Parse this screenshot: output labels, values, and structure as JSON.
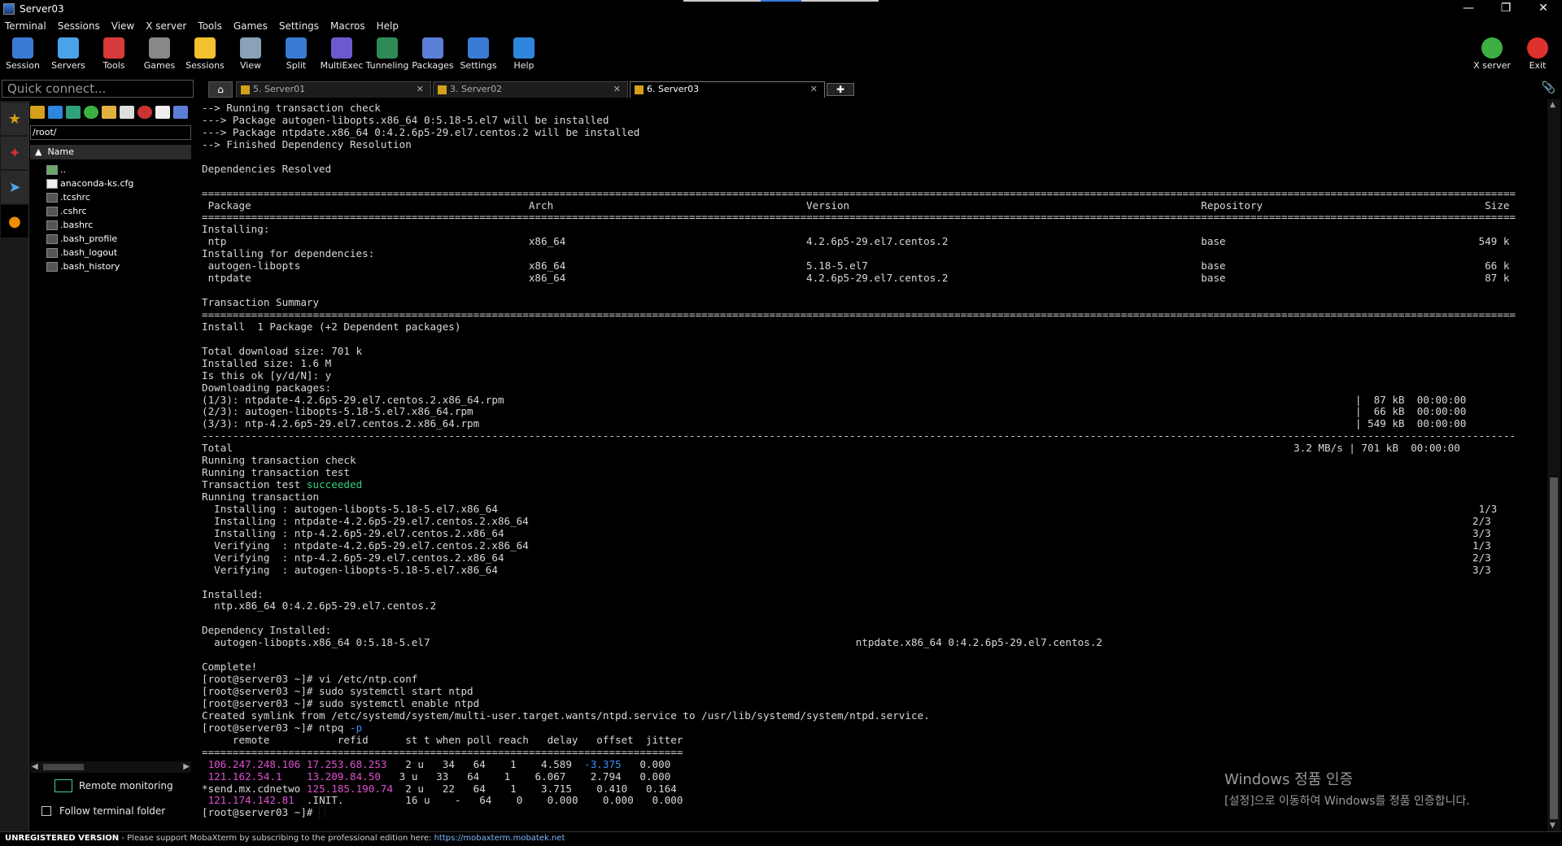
{
  "window": {
    "title": "Server03"
  },
  "menu": [
    "Terminal",
    "Sessions",
    "View",
    "X server",
    "Tools",
    "Games",
    "Settings",
    "Macros",
    "Help"
  ],
  "toolbar": [
    {
      "label": "Session",
      "icon": "session-icon",
      "color": "#3a7bd5"
    },
    {
      "label": "Servers",
      "icon": "servers-icon",
      "color": "#4aa3e8"
    },
    {
      "label": "Tools",
      "icon": "tools-icon",
      "color": "#d63a3a"
    },
    {
      "label": "Games",
      "icon": "games-icon",
      "color": "#888888"
    },
    {
      "label": "Sessions",
      "icon": "star-icon",
      "color": "#f2c12e"
    },
    {
      "label": "View",
      "icon": "view-icon",
      "color": "#8aa1b8"
    },
    {
      "label": "Split",
      "icon": "split-icon",
      "color": "#3a7bd5"
    },
    {
      "label": "MultiExec",
      "icon": "multiexec-icon",
      "color": "#6a5acd"
    },
    {
      "label": "Tunneling",
      "icon": "tunneling-icon",
      "color": "#2e8b57"
    },
    {
      "label": "Packages",
      "icon": "packages-icon",
      "color": "#5b7fd6"
    },
    {
      "label": "Settings",
      "icon": "gear-icon",
      "color": "#3a7bd5"
    },
    {
      "label": "Help",
      "icon": "help-icon",
      "color": "#2e86de"
    }
  ],
  "toolbar_right": [
    {
      "label": "X server",
      "icon": "xserver-icon",
      "color": "#3cb043"
    },
    {
      "label": "Exit",
      "icon": "power-icon",
      "color": "#e03030"
    }
  ],
  "quick_connect": {
    "placeholder": "Quick connect..."
  },
  "browser": {
    "path": "/root/",
    "column": "Name",
    "files": [
      "..",
      "anaconda-ks.cfg",
      ".tcshrc",
      ".cshrc",
      ".bashrc",
      ".bash_profile",
      ".bash_logout",
      ".bash_history"
    ],
    "remote_monitoring": "Remote monitoring",
    "follow_folder": "Follow terminal folder"
  },
  "tabs": [
    {
      "label": "5. Server01",
      "active": false
    },
    {
      "label": "3. Server02",
      "active": false
    },
    {
      "label": "6. Server03",
      "active": true
    }
  ],
  "terminal": {
    "lines_before_succeeded": "--> Running transaction check\n---> Package autogen-libopts.x86_64 0:5.18-5.el7 will be installed\n---> Package ntpdate.x86_64 0:4.2.6p5-29.el7.centos.2 will be installed\n--> Finished Dependency Resolution\n\nDependencies Resolved\n\n=====================================================================================================================================================================================================================\n Package                                             Arch                                         Version                                                         Repository                                    Size\n=====================================================================================================================================================================================================================\nInstalling:\n ntp                                                 x86_64                                       4.2.6p5-29.el7.centos.2                                         base                                         549 k\nInstalling for dependencies:\n autogen-libopts                                     x86_64                                       5.18-5.el7                                                      base                                          66 k\n ntpdate                                             x86_64                                       4.2.6p5-29.el7.centos.2                                         base                                          87 k\n\nTransaction Summary\n=====================================================================================================================================================================================================================\nInstall  1 Package (+2 Dependent packages)\n\nTotal download size: 701 k\nInstalled size: 1.6 M\nIs this ok [y/d/N]: y\nDownloading packages:\n(1/3): ntpdate-4.2.6p5-29.el7.centos.2.x86_64.rpm                                                                                                                                          |  87 kB  00:00:00\n(2/3): autogen-libopts-5.18-5.el7.x86_64.rpm                                                                                                                                               |  66 kB  00:00:00\n(3/3): ntp-4.2.6p5-29.el7.centos.2.x86_64.rpm                                                                                                                                              | 549 kB  00:00:00\n---------------------------------------------------------------------------------------------------------------------------------------------------------------------------------------------------------------------\nTotal                                                                                                                                                                            3.2 MB/s | 701 kB  00:00:00\nRunning transaction check\nRunning transaction test\nTransaction test ",
    "succeeded": "succeeded",
    "lines_after_succeeded": "\nRunning transaction\n  Installing : autogen-libopts-5.18-5.el7.x86_64                                                                                                                                                               1/3\n  Installing : ntpdate-4.2.6p5-29.el7.centos.2.x86_64                                                                                                                                                         2/3\n  Installing : ntp-4.2.6p5-29.el7.centos.2.x86_64                                                                                                                                                             3/3\n  Verifying  : ntpdate-4.2.6p5-29.el7.centos.2.x86_64                                                                                                                                                         1/3\n  Verifying  : ntp-4.2.6p5-29.el7.centos.2.x86_64                                                                                                                                                             2/3\n  Verifying  : autogen-libopts-5.18-5.el7.x86_64                                                                                                                                                              3/3\n\nInstalled:\n  ntp.x86_64 0:4.2.6p5-29.el7.centos.2\n\nDependency Installed:\n  autogen-libopts.x86_64 0:5.18-5.el7                                                                     ntpdate.x86_64 0:4.2.6p5-29.el7.centos.2\n\nComplete!\n[root@server03 ~]# vi /etc/ntp.conf\n[root@server03 ~]# sudo systemctl start ntpd\n[root@server03 ~]# sudo systemctl enable ntpd\nCreated symlink from /etc/systemd/system/multi-user.target.wants/ntpd.service to /usr/lib/systemd/system/ntpd.service.\n[root@server03 ~]# ntpq ",
    "ntpq_flag": "-p",
    "ntpq_header": "\n     remote           refid      st t when poll reach   delay   offset  jitter\n==============================================================================\n",
    "ntpq_rows": [
      {
        "prefix": " ",
        "remote": "106.247.248.106",
        "refid": "17.253.68.253",
        "rest": "   2 u   34   64    1    4.589  ",
        "offset": "-3.375",
        "tail": "   0.000"
      },
      {
        "prefix": " ",
        "remote": "121.162.54.1",
        "refid": "13.209.84.50",
        "rest": "   3 u   33   64    1    6.067    2.794   0.000",
        "offset": "",
        "tail": ""
      },
      {
        "prefix": "*",
        "remote": "send.mx.cdnetwo",
        "refid": "125.185.190.74",
        "rest": "  2 u   22   64    1    3.715    0.410   0.164",
        "offset": "",
        "tail": ""
      },
      {
        "prefix": " ",
        "remote": "121.174.142.81",
        "refid": ".INIT.",
        "rest": "          16 u    -   64    0    0.000    0.000   0.000",
        "offset": "",
        "tail": ""
      }
    ],
    "prompt": "[root@server03 ~]# "
  },
  "watermark": {
    "line1": "Windows 정품 인증",
    "line2": "[설정]으로 이동하여 Windows를 정품 인증합니다."
  },
  "status": {
    "unregistered": "UNREGISTERED VERSION",
    "message": "  -  Please support MobaXterm by subscribing to the professional edition here:  ",
    "link": "https://mobaxterm.mobatek.net"
  }
}
